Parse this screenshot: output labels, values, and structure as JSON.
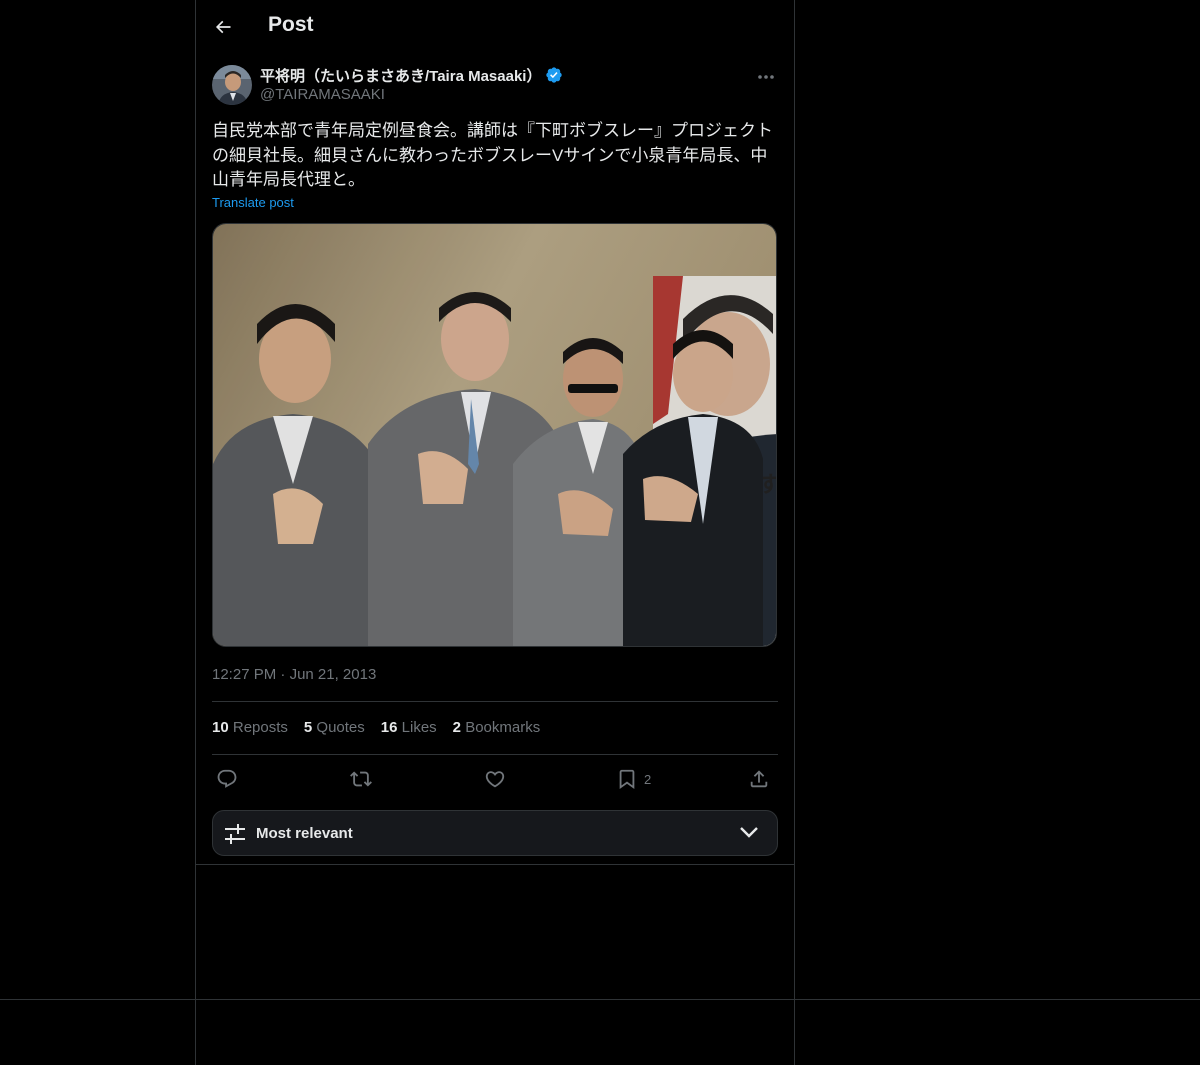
{
  "header": {
    "title": "Post"
  },
  "author": {
    "name": "平将明（たいらまさあき/Taira Masaaki）",
    "handle": "@TAIRAMASAAKI",
    "verified": true
  },
  "post": {
    "text": "自民党本部で青年局定例昼食会。講師は『下町ボブスレー』プロジェクトの細貝社長。細貝さんに教わったボブスレーVサインで小泉青年局長、中山青年局長代理と。",
    "translate_label": "Translate post",
    "time": "12:27 PM",
    "dot": "·",
    "date": "Jun 21, 2013",
    "image_alt": "Photo of four men in suits making a hand sign"
  },
  "stats": {
    "reposts_count": "10",
    "reposts_label": "Reposts",
    "quotes_count": "5",
    "quotes_label": "Quotes",
    "likes_count": "16",
    "likes_label": "Likes",
    "bookmarks_count": "2",
    "bookmarks_label": "Bookmarks"
  },
  "actions": {
    "bookmark_count": "2"
  },
  "sort": {
    "label": "Most relevant"
  },
  "colors": {
    "background": "#000000",
    "text": "#e7e9ea",
    "muted": "#71767b",
    "accent": "#1d9bf0",
    "border": "#2f3336"
  },
  "icons": [
    "back-arrow-icon",
    "verified-badge-icon",
    "more-icon",
    "reply-icon",
    "repost-icon",
    "like-icon",
    "bookmark-icon",
    "share-icon",
    "sliders-icon",
    "chevron-down-icon"
  ]
}
